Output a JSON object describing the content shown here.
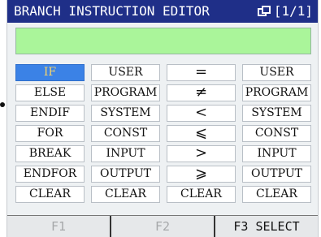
{
  "window": {
    "title": "BRANCH INSTRUCTION EDITOR",
    "page_indicator": "[1/1]"
  },
  "input": {
    "value": ""
  },
  "grid": {
    "columns": [
      [
        "IF",
        "ELSE",
        "ENDIF",
        "FOR",
        "BREAK",
        "ENDFOR",
        "CLEAR"
      ],
      [
        "USER",
        "PROGRAM",
        "SYSTEM",
        "CONST",
        "INPUT",
        "OUTPUT",
        "CLEAR"
      ],
      [
        "=",
        "≠",
        "<",
        "⩽",
        ">",
        "⩾",
        "CLEAR"
      ],
      [
        "USER",
        "PROGRAM",
        "SYSTEM",
        "CONST",
        "INPUT",
        "OUTPUT",
        "CLEAR"
      ]
    ],
    "selected": "IF"
  },
  "function_keys": [
    "F1",
    "F2",
    "F3 SELECT"
  ],
  "colors": {
    "titlebar": "#1f2f88",
    "input_bg": "#aaf59a",
    "selected_bg": "#3b82e6",
    "selected_text": "#f5d46a"
  }
}
